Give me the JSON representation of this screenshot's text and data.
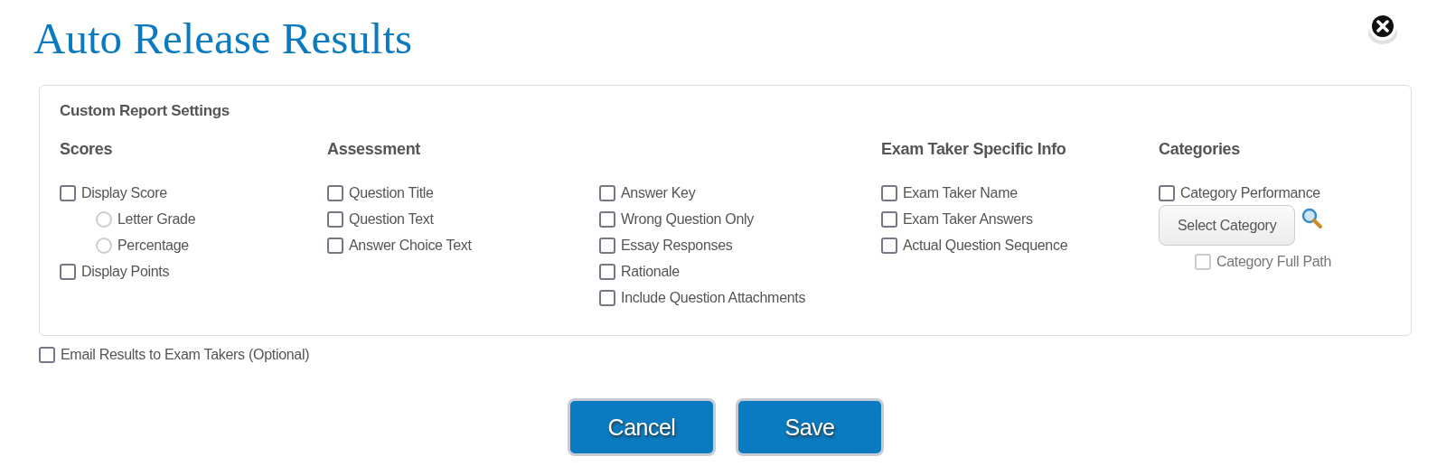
{
  "window": {
    "title": "Auto Release Results"
  },
  "panel": {
    "title": "Custom Report Settings",
    "sections": [
      {
        "heading": "Scores",
        "items": [
          {
            "kind": "checkbox",
            "label": "Display Score",
            "checked": false,
            "children": [
              {
                "kind": "radio",
                "label": "Letter Grade",
                "selected": false
              },
              {
                "kind": "radio",
                "label": "Percentage",
                "selected": false
              }
            ]
          },
          {
            "kind": "checkbox",
            "label": "Display Points",
            "checked": false
          }
        ]
      },
      {
        "heading": "Assessment",
        "items": [
          {
            "kind": "checkbox",
            "label": "Question Title",
            "checked": false
          },
          {
            "kind": "checkbox",
            "label": "Question Text",
            "checked": false
          },
          {
            "kind": "checkbox",
            "label": "Answer Choice Text",
            "checked": false
          }
        ]
      },
      {
        "items": [
          {
            "kind": "checkbox",
            "label": "Answer Key",
            "checked": false
          },
          {
            "kind": "checkbox",
            "label": "Wrong Question Only",
            "checked": false
          },
          {
            "kind": "checkbox",
            "label": "Essay Responses",
            "checked": false
          },
          {
            "kind": "checkbox",
            "label": "Rationale",
            "checked": false
          },
          {
            "kind": "checkbox",
            "label": "Include Question Attachments",
            "checked": false
          }
        ]
      },
      {
        "heading": "Exam Taker Specific Info",
        "items": [
          {
            "kind": "checkbox",
            "label": "Exam Taker Name",
            "checked": false
          },
          {
            "kind": "checkbox",
            "label": "Exam Taker Answers",
            "checked": false
          },
          {
            "kind": "checkbox",
            "label": "Actual Question Sequence",
            "checked": false
          }
        ]
      },
      {
        "heading": "Categories",
        "items": [
          {
            "kind": "checkbox",
            "label": "Category Performance",
            "checked": false
          },
          {
            "kind": "button",
            "label": "Select Category",
            "children": [
              {
                "kind": "checkbox",
                "label": "Category Full Path",
                "checked": false,
                "disabled": true
              }
            ]
          }
        ]
      }
    ]
  },
  "email_option": {
    "label": "Email Results to Exam Takers (Optional)",
    "checked": false
  },
  "buttons": [
    {
      "label": "Cancel"
    },
    {
      "label": "Save"
    }
  ]
}
